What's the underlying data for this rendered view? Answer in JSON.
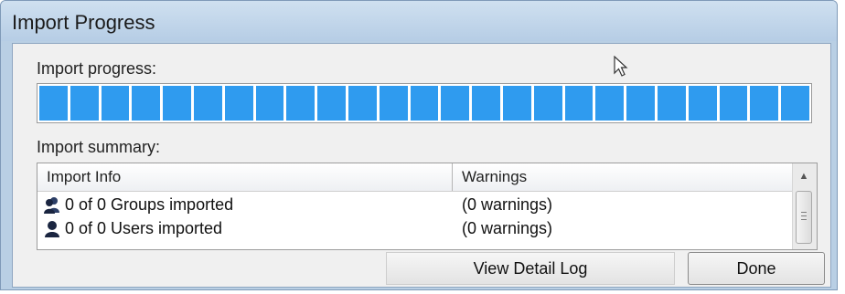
{
  "window": {
    "title": "Import Progress"
  },
  "progress": {
    "label": "Import progress:",
    "fraction": 1.0,
    "segments": 25,
    "color": "#2f9bef"
  },
  "summary": {
    "label": "Import summary:",
    "columns": [
      "Import Info",
      "Warnings"
    ],
    "rows": [
      {
        "icon": "groups-icon",
        "info": "0 of 0 Groups imported",
        "warnings": "(0 warnings)"
      },
      {
        "icon": "user-icon",
        "info": "0 of 0 Users imported",
        "warnings": "(0 warnings)"
      }
    ]
  },
  "buttons": {
    "view_log": "View Detail Log",
    "done": "Done"
  }
}
